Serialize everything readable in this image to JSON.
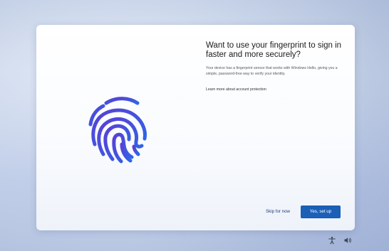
{
  "oobe": {
    "title": "Want to use your fingerprint to sign in faster and more securely?",
    "description": "Your device has a fingerprint sensor that works with Windows Hello, giving you a simple, password-free way to verify your identity.",
    "learn_more": "Learn more about account protection",
    "skip_label": "Skip for now",
    "confirm_label": "Yes, set up"
  },
  "icons": {
    "illustration": "fingerprint-icon",
    "accessibility": "accessibility-icon",
    "volume": "volume-icon"
  },
  "colors": {
    "accent": "#1b5fb6",
    "fingerprint_gradient_start": "#4f3fd0",
    "fingerprint_gradient_end": "#2f63e6"
  }
}
